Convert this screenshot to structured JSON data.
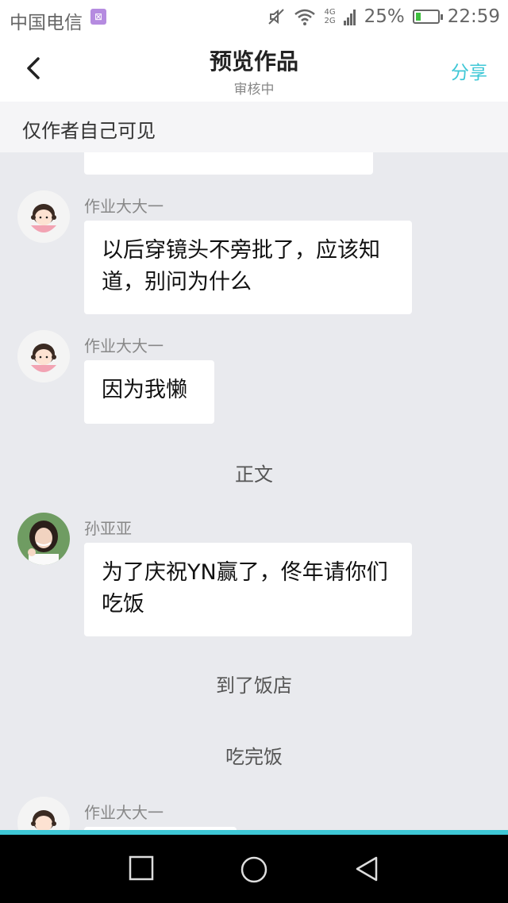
{
  "status_bar": {
    "carrier": "中国电信",
    "network_top": "4G",
    "network_bottom": "2G",
    "battery_percent": "25%",
    "time": "22:59",
    "battery_level": 0.25
  },
  "nav": {
    "title": "预览作品",
    "subtitle": "审核中",
    "share_label": "分享"
  },
  "notice": "仅作者自己可见",
  "messages": [
    {
      "sender": "作业大大一",
      "text": "以后穿镜头不旁批了，应该知道，别问为什么"
    },
    {
      "sender": "作业大大一",
      "text": "因为我懒"
    },
    {
      "narration": "正文"
    },
    {
      "sender": "孙亚亚",
      "text": "为了庆祝YN赢了，佟年请你们吃饭"
    },
    {
      "narration": "到了饭店"
    },
    {
      "narration": "吃完饭"
    },
    {
      "sender": "作业大大一"
    }
  ],
  "colors": {
    "accent": "#3ec7d6",
    "background": "#e9eaee"
  }
}
